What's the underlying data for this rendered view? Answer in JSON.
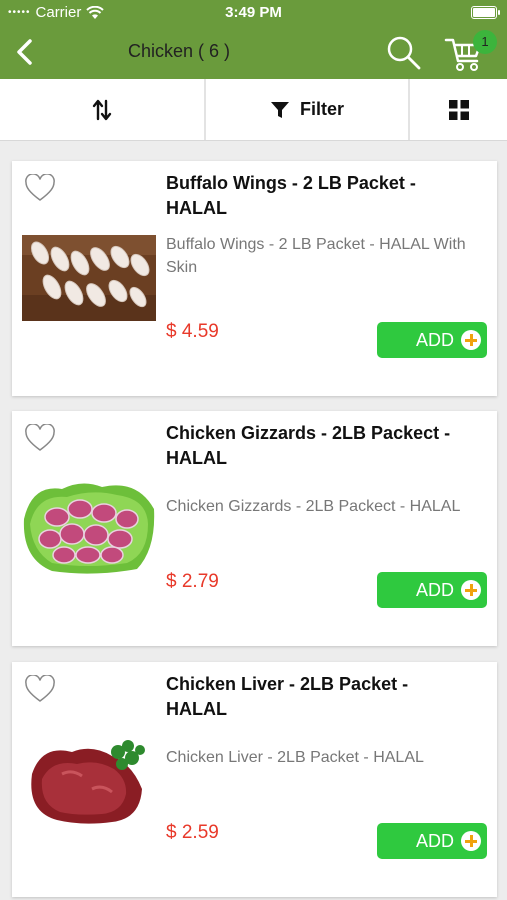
{
  "status_bar": {
    "carrier": "Carrier",
    "time": "3:49 PM"
  },
  "nav": {
    "title": "Chicken ( 6 )",
    "cart_count": "1",
    "bar_color": "#6a9b3c"
  },
  "toolbar": {
    "filter_label": "Filter"
  },
  "products": [
    {
      "name": "Buffalo Wings - 2 LB Packet - HALAL",
      "description": "Buffalo Wings - 2 LB Packet - HALAL With Skin",
      "price": "$ 4.59",
      "add_label": "ADD"
    },
    {
      "name": "Chicken Gizzards - 2LB Packect - HALAL",
      "description": "Chicken Gizzards - 2LB Packect - HALAL",
      "price": "$ 2.79",
      "add_label": "ADD"
    },
    {
      "name": "Chicken Liver - 2LB Packet - HALAL",
      "description": "Chicken Liver - 2LB Packet - HALAL",
      "price": "$ 2.59",
      "add_label": "ADD"
    }
  ],
  "colors": {
    "price": "#e8392a",
    "add_button": "#2fc93f",
    "plus_icon": "#f0a20d"
  }
}
